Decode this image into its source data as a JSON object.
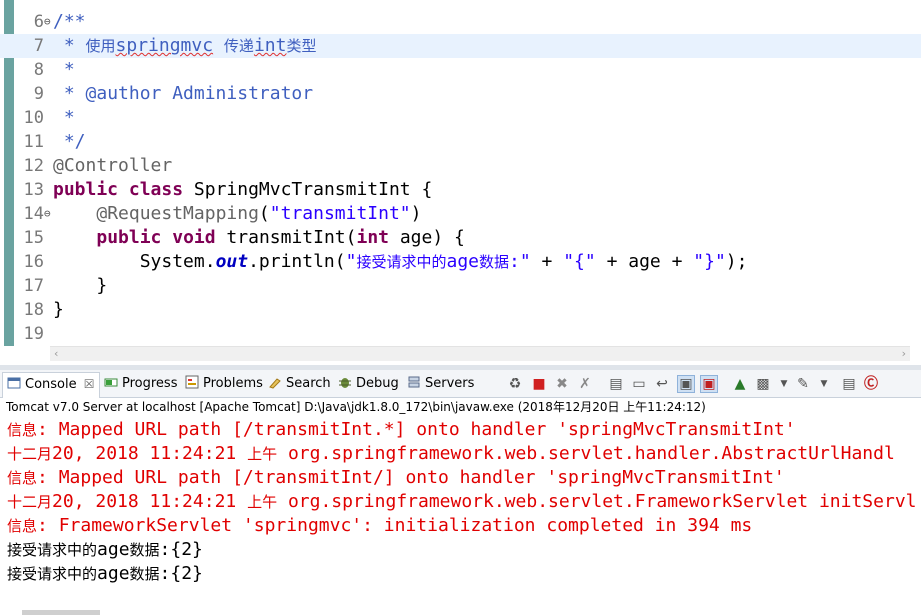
{
  "editor": {
    "lines": [
      {
        "num": "6",
        "fold": "⊖",
        "parts": [
          {
            "c": "cmt",
            "t": "/**"
          }
        ]
      },
      {
        "num": "7",
        "fold": "",
        "highlight": true,
        "parts": [
          {
            "c": "cmt",
            "t": " * "
          },
          {
            "c": "cmt cjk",
            "t": "使用"
          },
          {
            "c": "cmt squiggle",
            "t": "springmvc"
          },
          {
            "c": "cmt",
            "t": " "
          },
          {
            "c": "cmt cjk",
            "t": "传递"
          },
          {
            "c": "cmt squiggle",
            "t": "int"
          },
          {
            "c": "cmt cjk",
            "t": "类型"
          }
        ]
      },
      {
        "num": "8",
        "fold": "",
        "parts": [
          {
            "c": "cmt",
            "t": " *"
          }
        ]
      },
      {
        "num": "9",
        "fold": "",
        "parts": [
          {
            "c": "cmt",
            "t": " * "
          },
          {
            "c": "cmt",
            "t": "@author"
          },
          {
            "c": "cmt",
            "t": " Administrator"
          }
        ]
      },
      {
        "num": "10",
        "fold": "",
        "parts": [
          {
            "c": "cmt",
            "t": " *"
          }
        ]
      },
      {
        "num": "11",
        "fold": "",
        "parts": [
          {
            "c": "cmt",
            "t": " */"
          }
        ]
      },
      {
        "num": "12",
        "fold": "",
        "parts": [
          {
            "c": "ann",
            "t": "@Controller"
          }
        ]
      },
      {
        "num": "13",
        "fold": "",
        "parts": [
          {
            "c": "kw",
            "t": "public"
          },
          {
            "c": "plain",
            "t": " "
          },
          {
            "c": "kw",
            "t": "class"
          },
          {
            "c": "plain",
            "t": " SpringMvcTransmitInt {"
          }
        ]
      },
      {
        "num": "14",
        "fold": "⊖",
        "parts": [
          {
            "c": "plain",
            "t": "    "
          },
          {
            "c": "ann",
            "t": "@RequestMapping"
          },
          {
            "c": "plain",
            "t": "("
          },
          {
            "c": "str",
            "t": "\"transmitInt\""
          },
          {
            "c": "plain",
            "t": ")"
          }
        ]
      },
      {
        "num": "15",
        "fold": "",
        "parts": [
          {
            "c": "plain",
            "t": "    "
          },
          {
            "c": "kw",
            "t": "public"
          },
          {
            "c": "plain",
            "t": " "
          },
          {
            "c": "kw",
            "t": "void"
          },
          {
            "c": "plain",
            "t": " transmitInt("
          },
          {
            "c": "kw",
            "t": "int"
          },
          {
            "c": "plain",
            "t": " age) {"
          }
        ]
      },
      {
        "num": "16",
        "fold": "",
        "parts": [
          {
            "c": "plain",
            "t": "        System."
          },
          {
            "c": "fld",
            "t": "out"
          },
          {
            "c": "plain",
            "t": ".println("
          },
          {
            "c": "str",
            "t": "\""
          },
          {
            "c": "str cjk",
            "t": "接受请求中的"
          },
          {
            "c": "str",
            "t": "age"
          },
          {
            "c": "str cjk",
            "t": "数据"
          },
          {
            "c": "str",
            "t": ":\""
          },
          {
            "c": "plain",
            "t": " + "
          },
          {
            "c": "str",
            "t": "\"{\""
          },
          {
            "c": "plain",
            "t": " + age + "
          },
          {
            "c": "str",
            "t": "\"}\""
          },
          {
            "c": "plain",
            "t": ");"
          }
        ]
      },
      {
        "num": "17",
        "fold": "",
        "parts": [
          {
            "c": "plain",
            "t": "    }"
          }
        ]
      },
      {
        "num": "18",
        "fold": "",
        "parts": [
          {
            "c": "plain",
            "t": "}"
          }
        ]
      },
      {
        "num": "19",
        "fold": "",
        "parts": []
      }
    ]
  },
  "console_view": {
    "tabs": [
      {
        "label": "Console",
        "icon": "console-icon",
        "active": true,
        "close": "☒"
      },
      {
        "label": "Progress",
        "icon": "progress-icon"
      },
      {
        "label": "Problems",
        "icon": "problems-icon"
      },
      {
        "label": "Search",
        "icon": "search-icon"
      },
      {
        "label": "Debug",
        "icon": "debug-icon"
      },
      {
        "label": "Servers",
        "icon": "servers-icon"
      }
    ],
    "toolbar_icons": [
      "link-icon",
      "terminate-icon",
      "remove-launch-icon",
      "remove-all-icon",
      "clear-console-icon",
      "scroll-lock-icon",
      "word-wrap-icon",
      "show-on-stdout-icon",
      "show-on-stderr-icon",
      "pin-console-icon",
      "display-console-icon",
      "display-console-dropdown-icon",
      "open-console-icon",
      "open-console-dropdown-icon",
      "minimize-icon",
      "maximize-icon"
    ],
    "status": "Tomcat v7.0 Server at localhost [Apache Tomcat] D:\\Java\\jdk1.8.0_172\\bin\\javaw.exe (2018年12月20日 上午11:24:12)",
    "lines": [
      {
        "red": true,
        "parts": [
          {
            "cjk": true,
            "t": "信息"
          },
          {
            "t": ": Mapped URL path [/transmitInt.*] onto handler 'springMvcTransmitInt'"
          }
        ]
      },
      {
        "red": true,
        "parts": [
          {
            "cjk": true,
            "t": "十二月"
          },
          {
            "t": "20, 2018 11:24:21 "
          },
          {
            "cjk": true,
            "t": "上午"
          },
          {
            "t": " org.springframework.web.servlet.handler.AbstractUrlHandl"
          }
        ]
      },
      {
        "red": true,
        "parts": [
          {
            "cjk": true,
            "t": "信息"
          },
          {
            "t": ": Mapped URL path [/transmitInt/] onto handler 'springMvcTransmitInt'"
          }
        ]
      },
      {
        "red": true,
        "parts": [
          {
            "cjk": true,
            "t": "十二月"
          },
          {
            "t": "20, 2018 11:24:21 "
          },
          {
            "cjk": true,
            "t": "上午"
          },
          {
            "t": " org.springframework.web.servlet.FrameworkServlet initServl"
          }
        ]
      },
      {
        "red": true,
        "parts": [
          {
            "cjk": true,
            "t": "信息"
          },
          {
            "t": ": FrameworkServlet 'springmvc': initialization completed in 394 ms"
          }
        ]
      },
      {
        "red": false,
        "parts": [
          {
            "cjk": true,
            "t": "接受请求中的"
          },
          {
            "t": "age"
          },
          {
            "cjk": true,
            "t": "数据"
          },
          {
            "t": ":{2}"
          }
        ]
      },
      {
        "red": false,
        "parts": [
          {
            "cjk": true,
            "t": "接受请求中的"
          },
          {
            "t": "age"
          },
          {
            "cjk": true,
            "t": "数据"
          },
          {
            "t": ":{2}"
          }
        ]
      }
    ]
  },
  "colors": {
    "comment": "#3f5fbf",
    "keyword": "#7f0055",
    "string": "#2a00ff",
    "annotation": "#646464",
    "stderr": "#e00000",
    "current_line": "#e8f2fe"
  }
}
